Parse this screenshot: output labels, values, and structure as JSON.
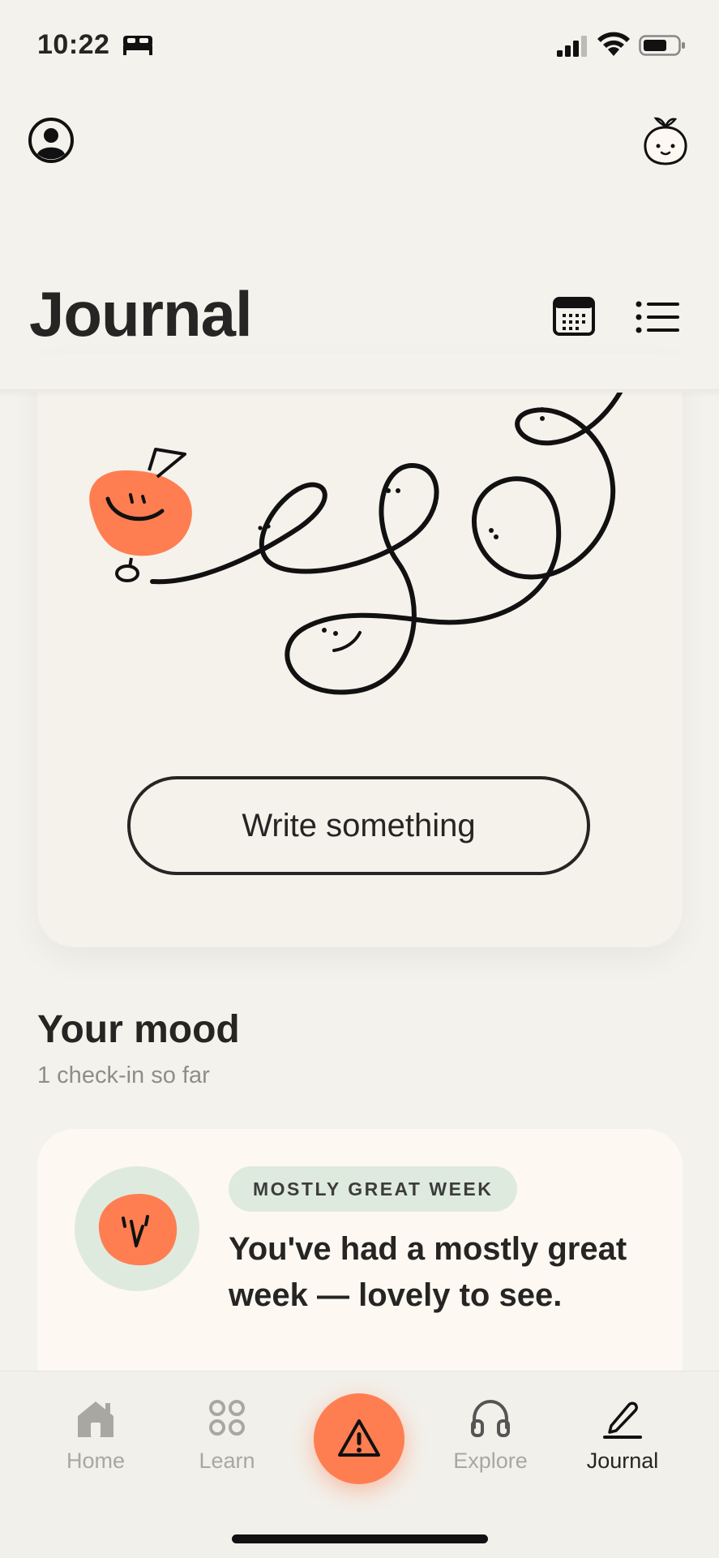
{
  "status_bar": {
    "time": "10:22",
    "icons": [
      "bed-icon",
      "signal-icon",
      "wifi-icon",
      "battery-icon"
    ]
  },
  "top_bar": {
    "icons": [
      "profile-icon",
      "baby-face-icon"
    ]
  },
  "header": {
    "title": "Journal",
    "icons": [
      "calendar-icon",
      "list-icon"
    ]
  },
  "hero": {
    "button_label": "Write something"
  },
  "mood": {
    "title": "Your mood",
    "subtitle": "1 check-in so far",
    "badge": "MOSTLY GREAT WEEK",
    "message": "You've had a mostly great week — lovely to see."
  },
  "nav": {
    "items": [
      {
        "label": "Home",
        "icon": "home-icon"
      },
      {
        "label": "Learn",
        "icon": "grid-icon"
      },
      {
        "label": "",
        "icon": "alert-icon"
      },
      {
        "label": "Explore",
        "icon": "headphones-icon"
      },
      {
        "label": "Journal",
        "icon": "pen-icon"
      }
    ],
    "active": "Journal"
  },
  "colors": {
    "background": "#f4f2ec",
    "accent": "#fe7e51",
    "badge_bg": "#dfeadf",
    "text": "#262523",
    "muted": "#8f8d88"
  }
}
